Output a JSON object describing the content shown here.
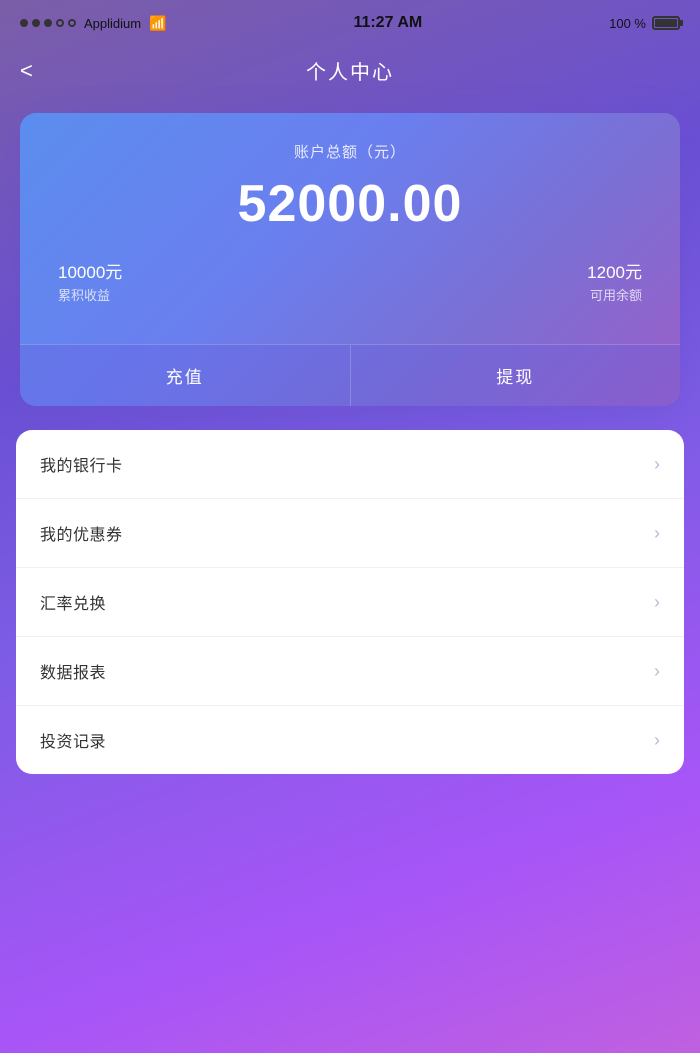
{
  "statusBar": {
    "carrier": "Applidium",
    "time": "11:27 AM",
    "battery": "100 %"
  },
  "header": {
    "backLabel": "<",
    "title": "个人中心"
  },
  "accountCard": {
    "label": "账户总额（元）",
    "amount": "52000.00",
    "stat1Value": "10000元",
    "stat1Label": "累积收益",
    "stat2Value": "1200元",
    "stat2Label": "可用余额",
    "btn1Label": "充值",
    "btn2Label": "提现"
  },
  "menuItems": [
    {
      "label": "我的银行卡"
    },
    {
      "label": "我的优惠券"
    },
    {
      "label": "汇率兑换"
    },
    {
      "label": "数据报表"
    },
    {
      "label": "投资记录"
    }
  ]
}
